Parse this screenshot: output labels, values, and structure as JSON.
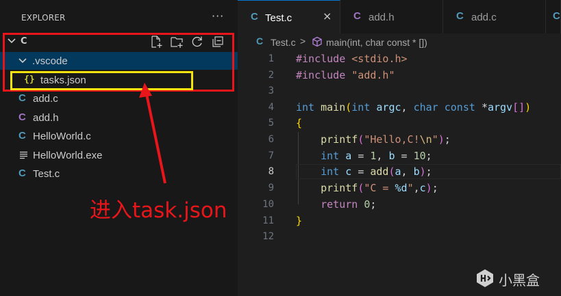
{
  "explorer": {
    "title": "EXPLORER",
    "more_icon": "more-horizontal-icon",
    "folder": "C",
    "toolbar": [
      "new-file-icon",
      "new-folder-icon",
      "refresh-icon",
      "collapse-all-icon"
    ],
    "items": [
      {
        "label": ".vscode",
        "type": "folder",
        "expanded": true,
        "selected": true
      },
      {
        "label": "tasks.json",
        "type": "json",
        "indent": 1
      },
      {
        "label": "add.c",
        "type": "c"
      },
      {
        "label": "add.h",
        "type": "h"
      },
      {
        "label": "HelloWorld.c",
        "type": "c"
      },
      {
        "label": "HelloWorld.exe",
        "type": "exe"
      },
      {
        "label": "Test.c",
        "type": "c"
      }
    ]
  },
  "annotation": {
    "text": "进入task.json",
    "color": "#e8161b",
    "highlight_color": "#f5e30e"
  },
  "tabs": [
    {
      "label": "Test.c",
      "icon": "C",
      "active": true,
      "close": "×"
    },
    {
      "label": "add.h",
      "icon": "C",
      "active": false
    },
    {
      "label": "add.c",
      "icon": "C",
      "active": false
    }
  ],
  "breadcrumb": {
    "file": "Test.c",
    "separator": ">",
    "symbol": "main(int, char const * [])"
  },
  "editor": {
    "current_line": 8,
    "line_numbers": [
      "1",
      "2",
      "3",
      "4",
      "5",
      "6",
      "7",
      "8",
      "9",
      "10",
      "11",
      "12"
    ]
  },
  "watermark": {
    "text": "小黑盒"
  },
  "icon_glyphs": {
    "c": "C",
    "json": "{}"
  }
}
